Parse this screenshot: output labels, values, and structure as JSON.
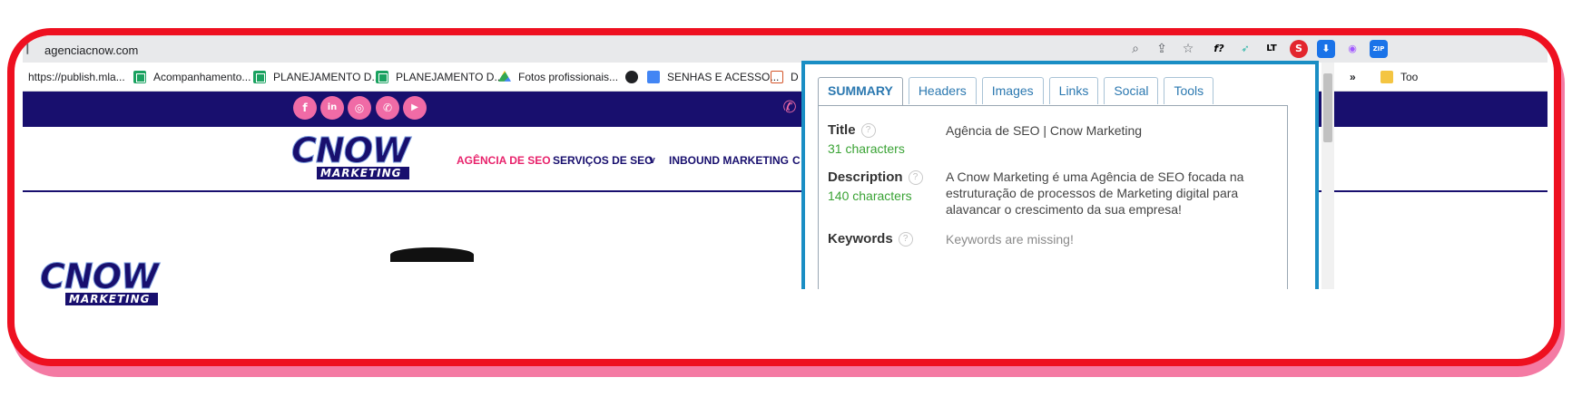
{
  "browser": {
    "url": "agenciacnow.com",
    "icons": [
      "zoom-icon",
      "share-icon",
      "star-icon"
    ],
    "extensions": [
      {
        "name": "fx-extension-icon",
        "glyph": "f?",
        "color": "#202124"
      },
      {
        "name": "green-bird-extension-icon",
        "glyph": "🐦",
        "color": "#2bb5a6"
      },
      {
        "name": "lt-extension-icon",
        "glyph": "LT",
        "color": "#202124"
      },
      {
        "name": "seo-extension-icon",
        "glyph": "S",
        "color": "#e3262d"
      },
      {
        "name": "download-extension-icon",
        "glyph": "⬇",
        "color": "#1a73e8"
      },
      {
        "name": "color-extension-icon",
        "glyph": "◉",
        "color": "#a259ff"
      },
      {
        "name": "zip-extension-icon",
        "glyph": "ZIP",
        "color": "#1a73e8"
      }
    ]
  },
  "bookmarks": {
    "items": [
      {
        "label": "https://publish.mla...",
        "icon": "none"
      },
      {
        "label": "Acompanhamento...",
        "icon": "sheet"
      },
      {
        "label": "PLANEJAMENTO D...",
        "icon": "sheet"
      },
      {
        "label": "PLANEJAMENTO D...",
        "icon": "sheet"
      },
      {
        "label": "Fotos profissionais...",
        "icon": "drive"
      },
      {
        "label": "",
        "icon": "globe"
      },
      {
        "label": "SENHAS E ACESSO...",
        "icon": "doc"
      },
      {
        "label": "D",
        "icon": "doc-outline"
      }
    ],
    "overflow": "»",
    "right_folder": "Too"
  },
  "site": {
    "social_icons": [
      "f",
      "in",
      "◎",
      "✆",
      "▶"
    ],
    "logo_big": "CNOW",
    "logo_small": "MARKETING",
    "nav": [
      {
        "label": "AGÊNCIA DE SEO",
        "active": true
      },
      {
        "label": "SERVIÇOS DE SEO",
        "active": false
      },
      {
        "label": "˅",
        "active": false
      },
      {
        "label": "INBOUND MARKETING",
        "active": false
      },
      {
        "label": "C",
        "active": false
      }
    ],
    "whatsapp_icon": "✆"
  },
  "seo_panel": {
    "tabs": [
      "SUMMARY",
      "Headers",
      "Images",
      "Links",
      "Social",
      "Tools"
    ],
    "active_tab": "SUMMARY",
    "help_glyph": "?",
    "title_label": "Title",
    "title_count": "31 characters",
    "title_value": "Agência de SEO | Cnow Marketing",
    "description_label": "Description",
    "description_count": "140 characters",
    "description_value": "A Cnow Marketing é uma Agência de SEO focada na estruturação de processos de Marketing digital para alavancar o crescimento da sua empresa!",
    "keywords_label": "Keywords",
    "keywords_value": "Keywords are missing!"
  },
  "colors": {
    "frame_border": "#ee1020",
    "navy": "#180f6e",
    "pink": "#f06ba6",
    "panel_border": "#1a8ec4",
    "count_green": "#3aa335"
  }
}
